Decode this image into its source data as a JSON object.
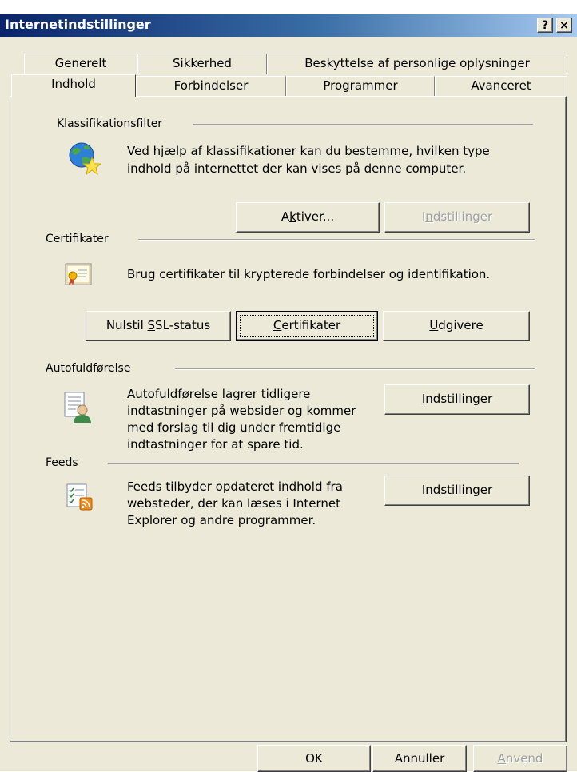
{
  "window": {
    "title": "Internetindstillinger",
    "help_button": "?",
    "close_button": "×"
  },
  "tabs": {
    "row1": [
      "Generelt",
      "Sikkerhed",
      "Beskyttelse af personlige oplysninger"
    ],
    "row2": [
      "Indhold",
      "Forbindelser",
      "Programmer",
      "Avanceret"
    ],
    "active": "Indhold"
  },
  "content_advisor": {
    "label": "Klassifikationsfilter",
    "icon": "globe-star-icon",
    "description_line1": "Ved hjælp af klassifikationer kan du bestemme, hvilken type",
    "description_line2": "indhold på internettet der kan vises på denne computer.",
    "enable_button": {
      "pre": "A",
      "key": "k",
      "post": "tiver..."
    },
    "settings_button": {
      "pre": "I",
      "key": "n",
      "post": "dstillinger",
      "disabled": true
    }
  },
  "certificates": {
    "label": "Certifikater",
    "icon": "certificate-icon",
    "description": "Brug certifikater til krypterede forbindelser og identifikation.",
    "clear_ssl_button": {
      "pre": "Nulstil ",
      "key": "S",
      "post": "SL-status"
    },
    "certificates_button": {
      "pre": "",
      "key": "C",
      "post": "ertifikater"
    },
    "publishers_button": {
      "pre": "",
      "key": "U",
      "post": "dgivere"
    }
  },
  "autocomplete": {
    "label": "Autofuldførelse",
    "icon": "autocomplete-user-icon",
    "description_lines": [
      "Autofuldførelse lagrer tidligere",
      "indtastninger på websider og kommer",
      "med forslag til dig under fremtidige",
      "indtastninger for at spare tid."
    ],
    "settings_button": {
      "pre": "",
      "key": "I",
      "post": "ndstillinger"
    }
  },
  "feeds": {
    "label": "Feeds",
    "icon": "feeds-rss-icon",
    "description_lines": [
      "Feeds tilbyder opdateret indhold fra",
      "websteder, der kan læses i Internet",
      "Explorer og andre programmer."
    ],
    "settings_button": {
      "pre": "In",
      "key": "d",
      "post": "stillinger"
    }
  },
  "footer": {
    "ok": "OK",
    "cancel": "Annuller",
    "apply": {
      "pre": "",
      "key": "A",
      "post": "nvend",
      "disabled": true
    }
  }
}
